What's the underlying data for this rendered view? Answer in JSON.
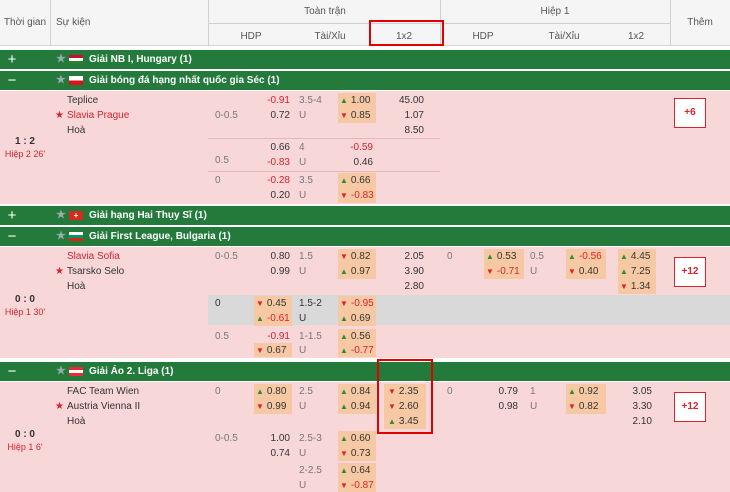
{
  "header": {
    "time": "Thời gian",
    "event": "Sự kiện",
    "full": "Toàn trận",
    "half": "Hiệp 1",
    "more": "Thêm",
    "hdp": "HDP",
    "ou": "Tài/Xỉu",
    "x12": "1x2"
  },
  "leagues": [
    {
      "pm": "+",
      "name": "Giải NB I, Hungary (1)"
    },
    {
      "pm": "−",
      "name": "Giải bóng đá hạng nhất quốc gia Séc (1)"
    },
    {
      "pm": "+",
      "name": "Giải hạng Hai Thụy Sĩ (1)"
    },
    {
      "pm": "−",
      "name": "Giải First League, Bulgaria (1)"
    },
    {
      "pm": "−",
      "name": "Giải Áo 2. Liga (1)"
    }
  ],
  "m1": {
    "home": "Teplice",
    "away": "Slavia Prague",
    "draw": "Hoà",
    "score": "1 : 2",
    "time": "Hiệp 2 26'",
    "more": "+6",
    "r1": {
      "hdp": "0-0.5",
      "h1": "-0.91",
      "h2": "0.72",
      "ou": "3.5-4",
      "u": "U",
      "o1": "1.00",
      "o2": "0.85",
      "x1": "45.00",
      "x2": "1.07",
      "x3": "8.50"
    },
    "r2": {
      "hdp": "0.5",
      "h1": "0.66",
      "h2": "-0.83",
      "ou": "4",
      "u": "U",
      "o1": "-0.59",
      "o2": "0.46"
    },
    "r3": {
      "hdp": "0",
      "h1": "-0.28",
      "h2": "0.20",
      "ou": "3.5",
      "u": "U",
      "o1": "0.66",
      "o2": "-0.83"
    }
  },
  "m2": {
    "home": "Slavia Sofia",
    "away": "Tsarsko Selo",
    "draw": "Hoà",
    "score": "0 : 0",
    "time": "Hiệp 1 30'",
    "more": "+12",
    "r1": {
      "hdp": "0-0.5",
      "h1": "0.80",
      "h2": "0.99",
      "ou": "1.5",
      "u": "U",
      "o1": "0.82",
      "o2": "0.97",
      "x1": "2.05",
      "x2": "3.90",
      "x3": "2.80",
      "hhdp": "0",
      "hh1": "0.53",
      "hh2": "-0.71",
      "hou": "0.5",
      "hu": "U",
      "ho1": "-0.56",
      "ho2": "0.40",
      "hx1": "4.45",
      "hx2": "7.25",
      "hx3": "1.34"
    },
    "r2": {
      "hdp": "0",
      "h1": "0.45",
      "h2": "-0.61",
      "ou": "1.5-2",
      "u": "U",
      "o1": "-0.95",
      "o2": "0.69"
    },
    "r3": {
      "hdp": "0.5",
      "h1": "-0.91",
      "h2": "0.67",
      "ou": "1-1.5",
      "u": "U",
      "o1": "0.56",
      "o2": "-0.77"
    }
  },
  "m3": {
    "home": "FAC Team Wien",
    "away": "Austria Vienna II",
    "draw": "Hoà",
    "score": "0 : 0",
    "time": "Hiệp 1 6'",
    "more": "+12",
    "r1": {
      "hdp": "0",
      "h1": "0.80",
      "h2": "0.99",
      "ou": "2.5",
      "u": "U",
      "o1": "0.84",
      "o2": "0.94",
      "x1": "2.35",
      "x2": "2.60",
      "x3": "3.45",
      "hhdp": "0",
      "hh1": "0.79",
      "hh2": "0.98",
      "hou": "1",
      "hu": "U",
      "ho1": "0.92",
      "ho2": "0.82",
      "hx1": "3.05",
      "hx2": "3.30",
      "hx3": "2.10"
    },
    "r2": {
      "hdp": "0-0.5",
      "h1": "1.00",
      "h2": "0.74",
      "ou": "2.5-3",
      "u": "U",
      "o1": "0.60",
      "o2": "0.73"
    },
    "r3": {
      "ou": "2-2.5",
      "u": "U",
      "o1": "0.64",
      "o2": "-0.87"
    }
  }
}
